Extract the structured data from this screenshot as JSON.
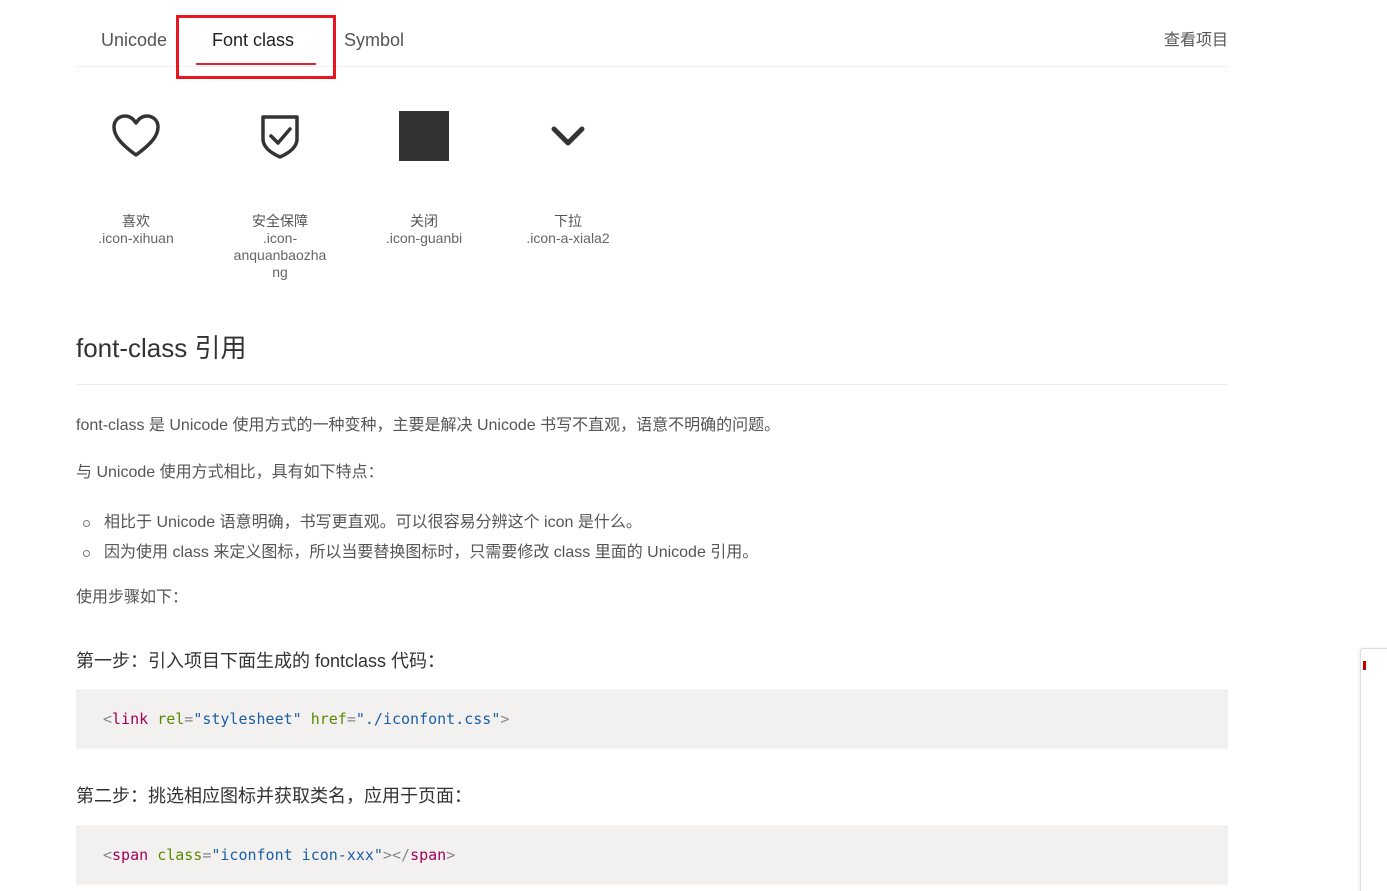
{
  "tabs": {
    "unicode": "Unicode",
    "font_class": "Font class",
    "symbol": "Symbol",
    "active": "Font class",
    "accent_color": "#e0242b"
  },
  "header": {
    "view_project": "查看项目"
  },
  "icons": [
    {
      "name": "喜欢",
      "code": ".icon-xihuan",
      "icon": "heart-icon"
    },
    {
      "name": "安全保障",
      "code": ".icon-anquanbaozhang",
      "icon": "shield-check-icon"
    },
    {
      "name": "关闭",
      "code": ".icon-guanbi",
      "icon": "square-icon"
    },
    {
      "name": "下拉",
      "code": ".icon-a-xiala2",
      "icon": "chevron-down-icon"
    }
  ],
  "content": {
    "section_title": "font-class 引用",
    "intro": "font-class 是 Unicode 使用方式的一种变种，主要是解决 Unicode 书写不直观，语意不明确的问题。",
    "compare": "与 Unicode 使用方式相比，具有如下特点：",
    "bullets": [
      "相比于 Unicode 语意明确，书写更直观。可以很容易分辨这个 icon 是什么。",
      "因为使用 class 来定义图标，所以当要替换图标时，只需要修改 class 里面的 Unicode 引用。"
    ],
    "steps_intro": "使用步骤如下：",
    "step1_title": "第一步：引入项目下面生成的 fontclass 代码：",
    "step1_code": {
      "open": "<",
      "tag": "link",
      "attr1": "rel",
      "eq": "=",
      "val1": "\"stylesheet\"",
      "attr2": "href",
      "val2": "\"./iconfont.css\"",
      "close": ">"
    },
    "step2_title": "第二步：挑选相应图标并获取类名，应用于页面：",
    "step2_code": {
      "open": "<",
      "tag": "span",
      "attr1": "class",
      "eq": "=",
      "val1": "\"iconfont icon-xxx\"",
      "mid": "></",
      "tag_close": "span",
      "close": ">"
    }
  }
}
